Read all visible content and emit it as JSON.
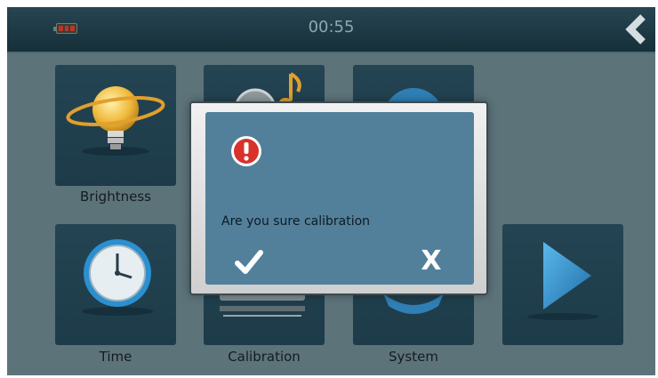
{
  "statusbar": {
    "time": "00:55",
    "battery_icon": "battery-low-icon",
    "back_icon": "back-arrow-icon"
  },
  "tiles": {
    "brightness": {
      "label": "Brightness",
      "icon": "lightbulb-icon"
    },
    "volume": {
      "label": "",
      "icon": "speaker-note-icon"
    },
    "language": {
      "label": "",
      "icon": "globe-icon"
    },
    "time": {
      "label": "Time",
      "icon": "clock-icon"
    },
    "calibration": {
      "label": "Calibration",
      "icon": "calibration-icon"
    },
    "system": {
      "label": "System",
      "icon": "gear-icon"
    },
    "next": {
      "icon": "next-page-arrow-icon"
    }
  },
  "dialog": {
    "message": "Are you sure calibration",
    "confirm_icon": "checkmark-icon",
    "cancel_label": "X",
    "alert_icon": "alert-icon"
  },
  "colors": {
    "background": "#5c737a",
    "statusbar": "#1d3944",
    "tile": "#213f4d",
    "dialog": "#52809b"
  }
}
